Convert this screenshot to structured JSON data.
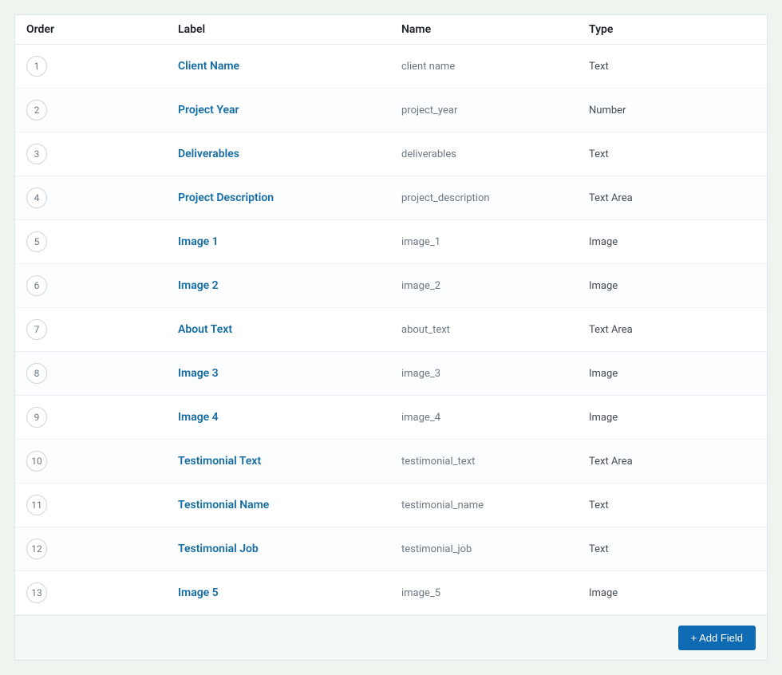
{
  "headers": {
    "order": "Order",
    "label": "Label",
    "name": "Name",
    "type": "Type"
  },
  "rows": [
    {
      "order": "1",
      "label": "Client Name",
      "name": "client name",
      "type": "Text"
    },
    {
      "order": "2",
      "label": "Project Year",
      "name": "project_year",
      "type": "Number"
    },
    {
      "order": "3",
      "label": "Deliverables",
      "name": "deliverables",
      "type": "Text"
    },
    {
      "order": "4",
      "label": "Project Description",
      "name": "project_description",
      "type": "Text Area"
    },
    {
      "order": "5",
      "label": "Image 1",
      "name": "image_1",
      "type": "Image"
    },
    {
      "order": "6",
      "label": "Image 2",
      "name": "image_2",
      "type": "Image"
    },
    {
      "order": "7",
      "label": "About Text",
      "name": "about_text",
      "type": "Text Area"
    },
    {
      "order": "8",
      "label": "Image 3",
      "name": "image_3",
      "type": "Image"
    },
    {
      "order": "9",
      "label": "Image 4",
      "name": "image_4",
      "type": "Image"
    },
    {
      "order": "10",
      "label": "Testimonial Text",
      "name": "testimonial_text",
      "type": "Text Area"
    },
    {
      "order": "11",
      "label": "Testimonial Name",
      "name": "testimonial_name",
      "type": "Text"
    },
    {
      "order": "12",
      "label": "Testimonial Job",
      "name": "testimonial_job",
      "type": "Text"
    },
    {
      "order": "13",
      "label": "Image 5",
      "name": "image_5",
      "type": "Image"
    }
  ],
  "footer": {
    "add_field_label": "+ Add Field"
  }
}
